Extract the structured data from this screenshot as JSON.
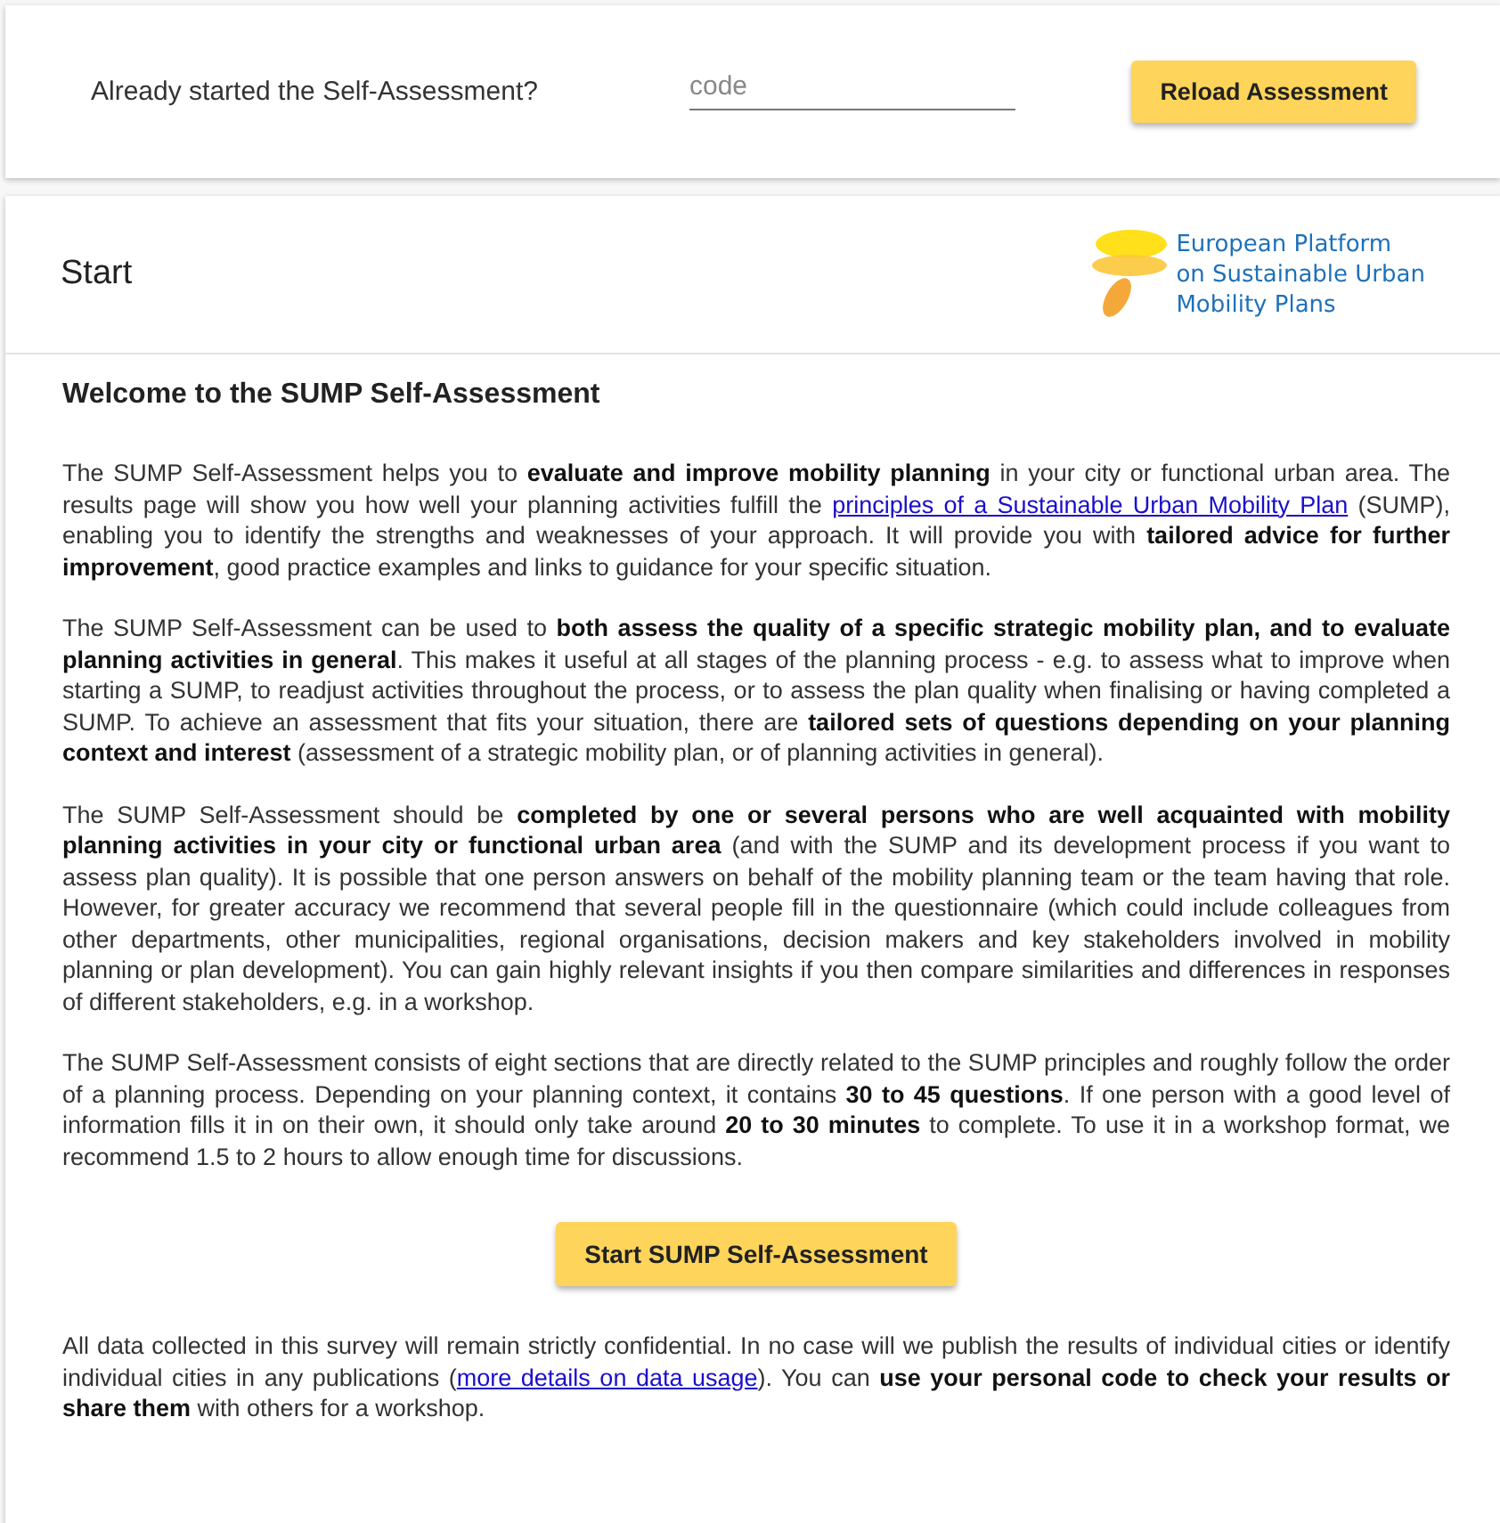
{
  "reload": {
    "prompt": "Already started the Self-Assessment?",
    "code_placeholder": "code",
    "button": "Reload Assessment"
  },
  "card": {
    "title": "Start",
    "logo_lines": [
      "European Platform",
      "on Sustainable Urban",
      "Mobility Plans"
    ]
  },
  "welcome": {
    "heading": "Welcome to the SUMP Self-Assessment",
    "paragraphs": [
      [
        {
          "kind": "text",
          "text": "The SUMP Self-Assessment helps you to **evaluate and improve mobility planning** in your city or functional urban area. The results page will show you how well your planning activities fulfill the "
        },
        {
          "kind": "link",
          "text": "principles of a Sustainable Urban Mobility Plan"
        },
        {
          "kind": "text",
          "text": " (SUMP), enabling you to identify the strengths and weaknesses of your approach. It will provide you with **tailored advice for further improvement**, good practice examples and links to guidance for your specific situation."
        }
      ],
      [
        {
          "kind": "text",
          "text": "The SUMP Self-Assessment can be used to **both assess the quality of a specific strategic mobility plan, and to evaluate planning activities in general**. This makes it useful at all stages of the planning process - e.g. to assess what to improve when starting a SUMP, to readjust activities throughout the process, or to assess the plan quality when finalising or having completed a SUMP. To achieve an assessment that fits your situation, there are **tailored sets of questions depending on your planning context and interest** (assessment of a strategic mobility plan, or of planning activities in general)."
        }
      ],
      [
        {
          "kind": "text",
          "text": "The SUMP Self-Assessment should be **completed by one or several persons who are well acquainted with mobility planning activities in your city or functional urban area** (and with the SUMP and its development process if you want to assess plan quality). It is possible that one person answers on behalf of the mobility planning team or the team having that role. However, for greater accuracy we recommend that several people fill in the questionnaire (which could include colleagues from other departments, other municipalities, regional organisations, decision makers and key stakeholders involved in mobility planning or plan development). You can gain highly relevant insights if you then compare similarities and differences in responses of different stakeholders, e.g. in a workshop."
        }
      ],
      [
        {
          "kind": "text",
          "text": "The SUMP Self-Assessment consists of eight sections that are directly related to the SUMP principles and roughly follow the order of a planning process. Depending on your planning context, it contains **30 to 45 questions**. If one person with a good level of information fills it in on their own, it should only take around **20 to 30 minutes** to complete. To use it in a workshop format, we recommend 1.5 to 2 hours to allow enough time for discussions."
        }
      ]
    ],
    "start_button": "Start SUMP Self-Assessment",
    "footer": [
      {
        "kind": "text",
        "text": "All data collected in this survey will remain strictly confidential. In no case will we publish the results of individual cities or identify individual cities in any publications ("
      },
      {
        "kind": "link",
        "text": "more details on data usage"
      },
      {
        "kind": "text",
        "text": "). You can **use your personal code to check your results or share them** with others for a workshop."
      }
    ]
  }
}
